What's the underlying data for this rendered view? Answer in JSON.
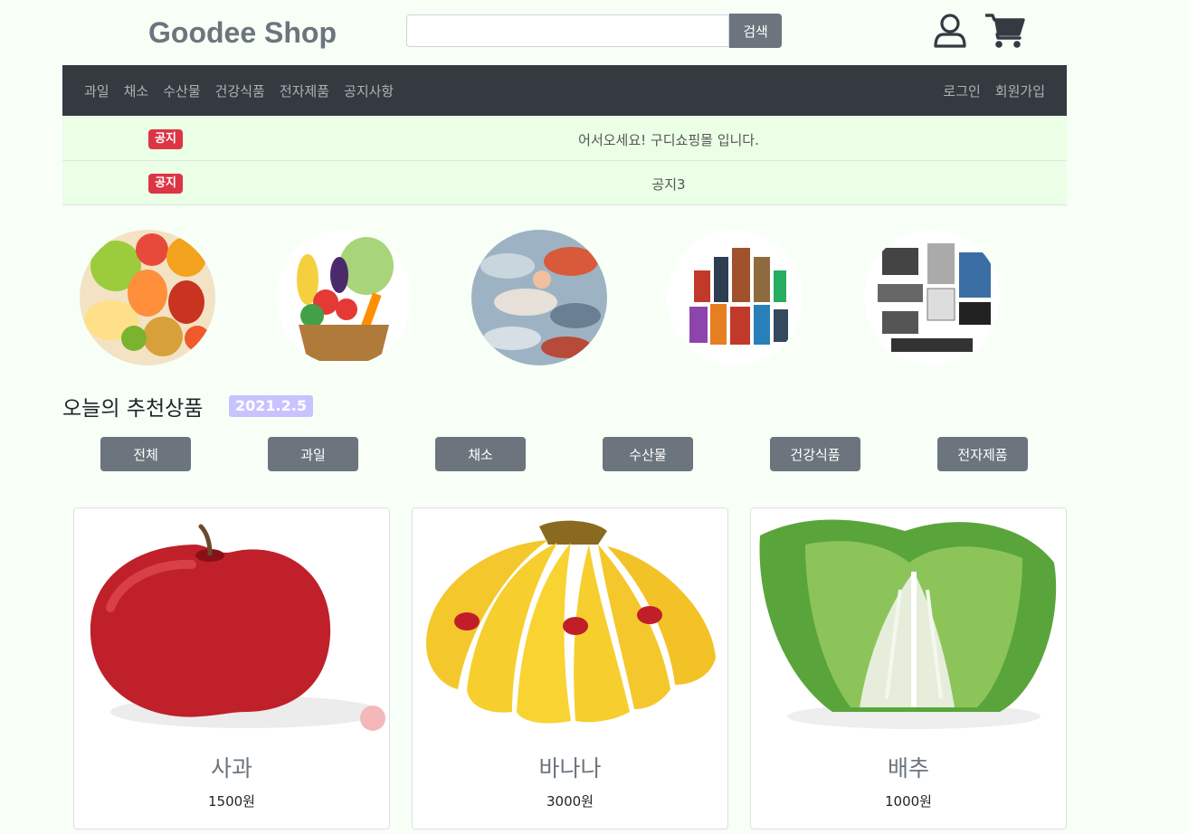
{
  "header": {
    "logo": "Goodee Shop",
    "search_placeholder": "",
    "search_button": "검색",
    "icons": [
      "user-icon",
      "cart-icon"
    ]
  },
  "nav": {
    "left": [
      "과일",
      "채소",
      "수산물",
      "건강식품",
      "전자제품",
      "공지사항"
    ],
    "right": [
      "로그인",
      "회원가입"
    ]
  },
  "notices": [
    {
      "badge": "공지",
      "text": "어서오세요! 구디쇼핑몰 입니다."
    },
    {
      "badge": "공지",
      "text": "공지3"
    }
  ],
  "recommend": {
    "title": "오늘의 추천상품",
    "date": "2021.2.5"
  },
  "filters": [
    "전체",
    "과일",
    "채소",
    "수산물",
    "건강식품",
    "전자제품"
  ],
  "products": [
    {
      "name": "사과",
      "price": "1500원"
    },
    {
      "name": "바나나",
      "price": "3000원"
    },
    {
      "name": "배추",
      "price": "1000원"
    }
  ],
  "colors": {
    "navbar": "#343a40",
    "notice_bg": "#eaffe6",
    "badge": "#dc3545",
    "button": "#6c757d",
    "date_badge": "#c8c3ff"
  }
}
